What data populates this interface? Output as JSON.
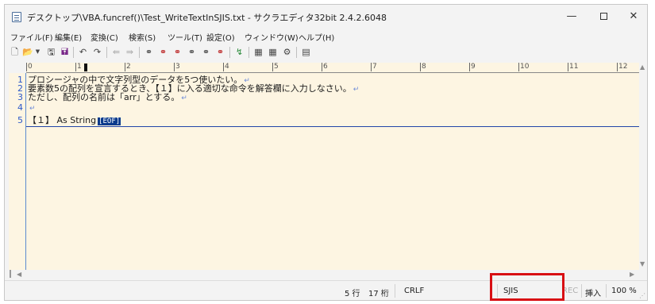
{
  "window": {
    "title": "デスクトップ\\VBA.funcref()\\Test_WriteTextInSJIS.txt - サクラエディタ32bit 2.4.2.6048",
    "controls": {
      "minimize": "—",
      "maximize": "☐",
      "close": "✕"
    }
  },
  "menu": [
    "ファイル(F)",
    "編集(E)",
    "変換(C)",
    "検索(S)",
    "ツール(T)",
    "設定(O)",
    "ウィンドウ(W)",
    "ヘルプ(H)"
  ],
  "toolbar": {
    "icons": [
      "new-file-icon",
      "open-folder-icon",
      "dropdown-arrow-icon",
      "save-icon",
      "save-all-icon",
      "undo-icon",
      "redo-icon",
      "back-icon",
      "forward-icon",
      "search-icon",
      "search-next-icon",
      "search-prev-icon",
      "replace-icon",
      "grep-icon",
      "find-icon",
      "jump-icon",
      "outline-icon",
      "compare-icon",
      "settings-icon",
      "window-icon"
    ]
  },
  "ruler": {
    "labels": [
      "0",
      "1",
      "2",
      "3",
      "4",
      "5",
      "6",
      "7",
      "8",
      "9",
      "10",
      "11",
      "12"
    ]
  },
  "editor": {
    "lines": [
      {
        "num": "1",
        "text": "プロシージャの中で文字列型のデータを5つ使いたい。",
        "ret": "↵"
      },
      {
        "num": "2",
        "text": "要素数5の配列を宣言するとき、【１】に入る適切な命令を解答欄に入力しなさい。",
        "ret": "↵"
      },
      {
        "num": "3",
        "text": "ただし、配列の名前は「arr」とする。",
        "ret": "↵"
      },
      {
        "num": "4",
        "text": "",
        "ret": "↵"
      },
      {
        "num": "5",
        "text": "【１】 As String",
        "ret": ""
      }
    ],
    "eof": "[EOF]"
  },
  "status": {
    "row": "5 行",
    "col": "17 桁",
    "newline": "CRLF",
    "encoding": "SJIS",
    "rec": "REC",
    "mode": "挿入",
    "zoom": "100 %"
  },
  "colors": {
    "highlight": "#d80f14",
    "line_numbers": "#2c58c8",
    "editor_bg": "#fdf5e2"
  }
}
